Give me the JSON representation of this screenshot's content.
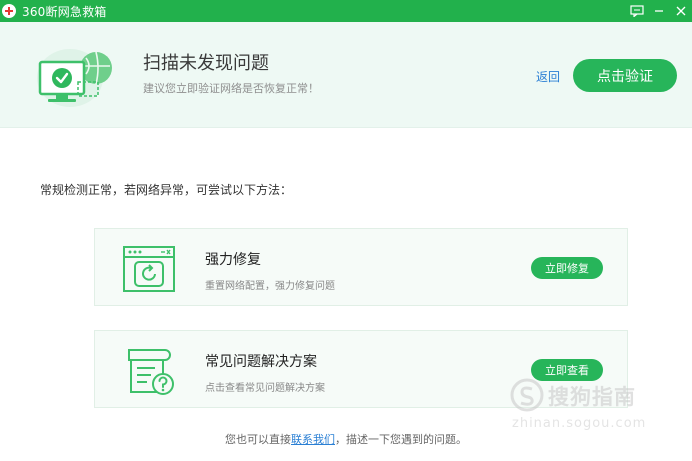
{
  "window": {
    "title": "360断网急救箱",
    "controls": [
      "feedback-icon",
      "minimize-icon",
      "close-icon"
    ]
  },
  "header": {
    "title": "扫描未发现问题",
    "subtitle": "建议您立即验证网络是否恢复正常！",
    "back_label": "返回",
    "verify_label": "点击验证"
  },
  "hint": "常规检测正常，若网络异常，可尝试以下方法：",
  "cards": [
    {
      "icon": "browser-repair-icon",
      "title": "强力修复",
      "desc": "重置网络配置，强力修复问题",
      "button": "立即修复"
    },
    {
      "icon": "document-question-icon",
      "title": "常见问题解决方案",
      "desc": "点击查看常见问题解决方案",
      "button": "立即查看"
    }
  ],
  "footer": {
    "prefix": "您也可以直接",
    "link": "联系我们",
    "suffix": "，描述一下您遇到的问题。"
  },
  "watermark": {
    "text": "搜狗指南",
    "url": "zhinan.sogou.com"
  },
  "colors": {
    "brand_green": "#22b14c",
    "button_green": "#27b55a",
    "link_blue": "#2a7fd4",
    "header_bg": "#eef9f4"
  }
}
